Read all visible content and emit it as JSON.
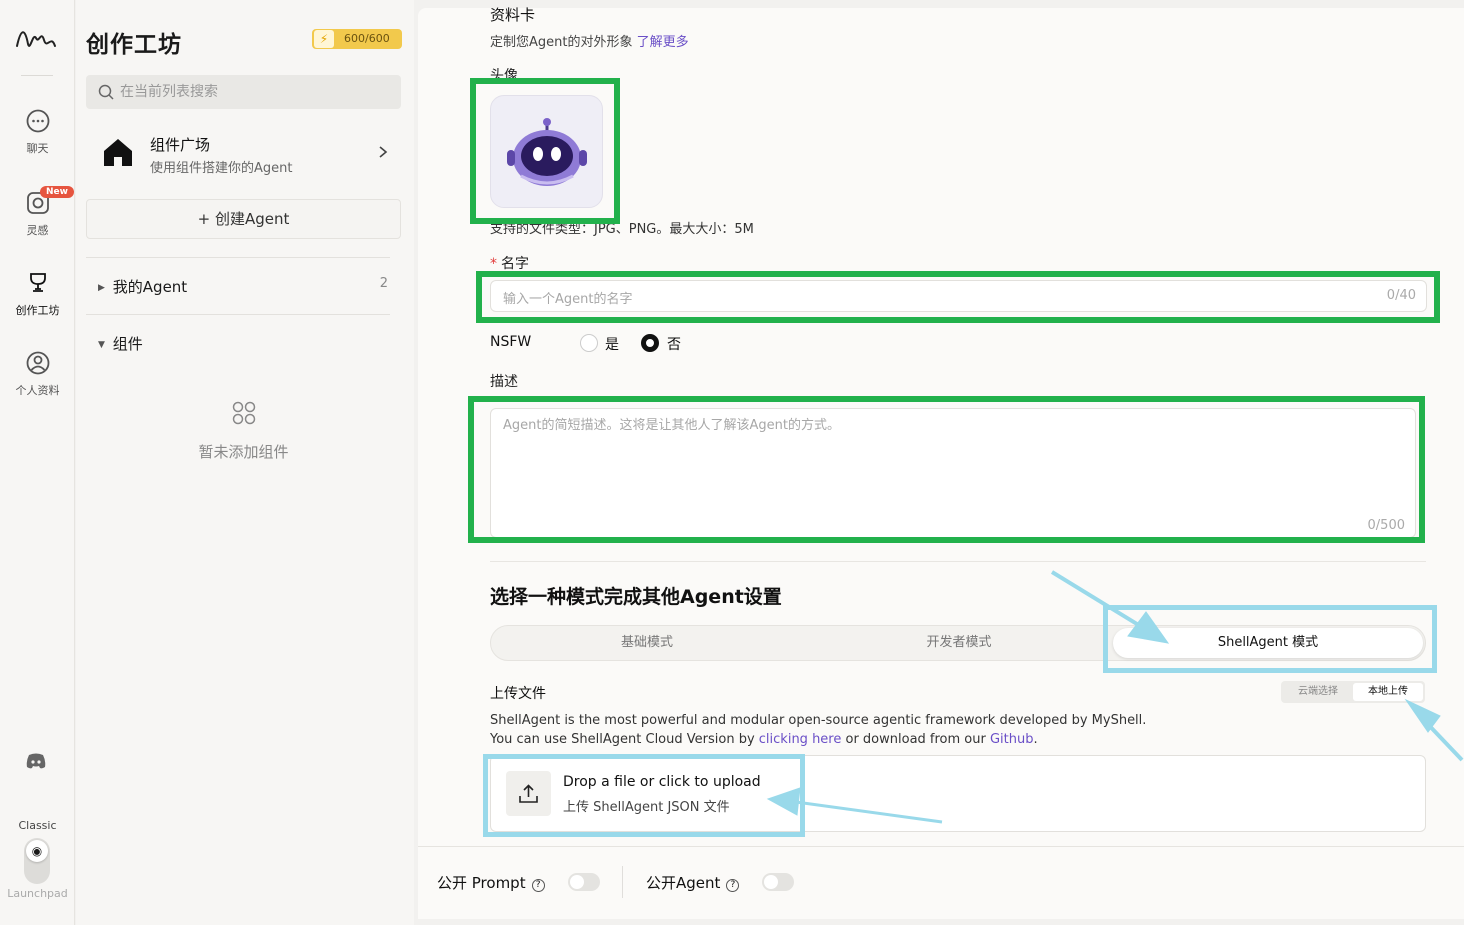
{
  "rail": {
    "items": [
      {
        "label": "聊天",
        "icon": "chat-bubble-icon"
      },
      {
        "label": "灵感",
        "icon": "instagram-icon",
        "badge": "New"
      },
      {
        "label": "创作工坊",
        "icon": "trophy-icon"
      },
      {
        "label": "个人资料",
        "icon": "user-circle-icon"
      }
    ],
    "classic_label": "Classic",
    "launchpad_label": "Launchpad"
  },
  "sidebar": {
    "title": "创作工坊",
    "quota": "600/600",
    "search_placeholder": "在当前列表搜索",
    "plaza_title": "组件广场",
    "plaza_subtitle": "使用组件搭建你的Agent",
    "create_label": "创建Agent",
    "my_agent_label": "我的Agent",
    "my_agent_count": "2",
    "components_label": "组件",
    "empty_text": "暂未添加组件"
  },
  "form": {
    "section_title": "资料卡",
    "section_subtitle": "定制您Agent的对外形象",
    "learn_more": "了解更多",
    "avatar_label": "头像",
    "file_hint": "支持的文件类型：JPG、PNG。最大大小：5M",
    "name_label": "名字",
    "name_placeholder": "输入一个Agent的名字",
    "name_count": "0/40",
    "nsfw_label": "NSFW",
    "nsfw_yes": "是",
    "nsfw_no": "否",
    "desc_label": "描述",
    "desc_placeholder": "Agent的简短描述。这将是让其他人了解该Agent的方式。",
    "desc_count": "0/500",
    "mode_title": "选择一种模式完成其他Agent设置",
    "modes": [
      "基础模式",
      "开发者模式",
      "ShellAgent 模式"
    ],
    "upload_title": "上传文件",
    "source_options": [
      "云端选择",
      "本地上传"
    ],
    "para1": "ShellAgent is the most powerful and modular open-source agentic framework developed by MyShell.",
    "para2_pre": "You can use ShellAgent Cloud Version by ",
    "para2_link1": "clicking here",
    "para2_mid": " or download from our ",
    "para2_link2": "Github",
    "para2_end": ".",
    "drop_title": "Drop a file or click to upload",
    "drop_subtitle": "上传 ShellAgent JSON 文件"
  },
  "footer": {
    "public_prompt": "公开 Prompt",
    "public_agent": "公开Agent"
  },
  "colors": {
    "accent_link": "#6a4fc7",
    "quota_bg": "#f2c94c",
    "annotation_green": "#22b14c",
    "annotation_blue": "#99d9ea",
    "new_badge": "#e6553f"
  }
}
